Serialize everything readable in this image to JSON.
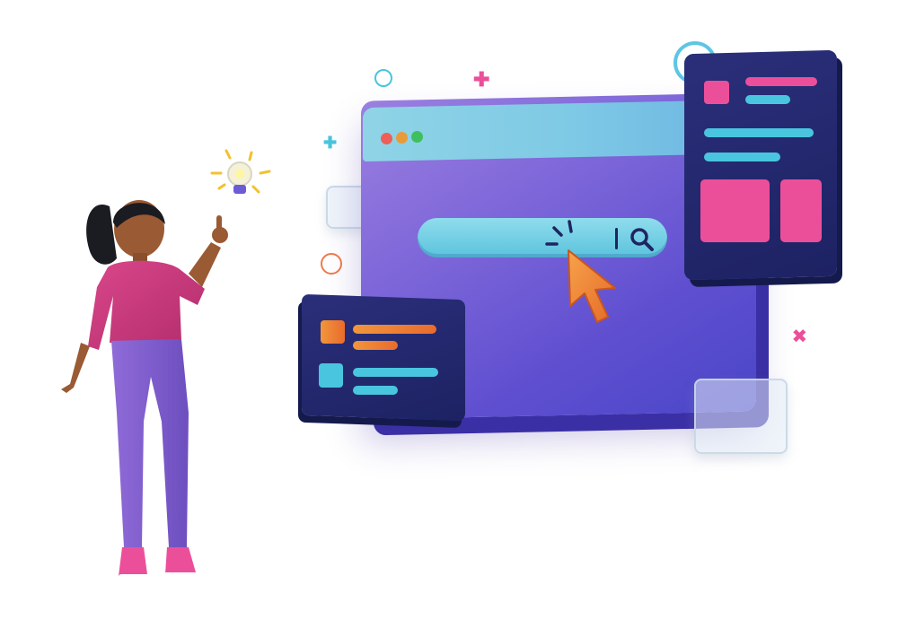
{
  "illustration": {
    "colors": {
      "browser_purple": "#7e67d9",
      "bar_cyan": "#7ec9e5",
      "panel_navy": "#1d2263",
      "accent_pink": "#ec4f9a",
      "accent_cyan": "#49c5df",
      "accent_orange": "#e96b2d",
      "window_dot_red": "#ee5f57",
      "window_dot_yellow": "#e99b3a",
      "window_dot_green": "#3fbf5f"
    },
    "icons": [
      "search-icon",
      "cursor-arrow-icon",
      "lightbulb-icon",
      "window-controls"
    ]
  }
}
